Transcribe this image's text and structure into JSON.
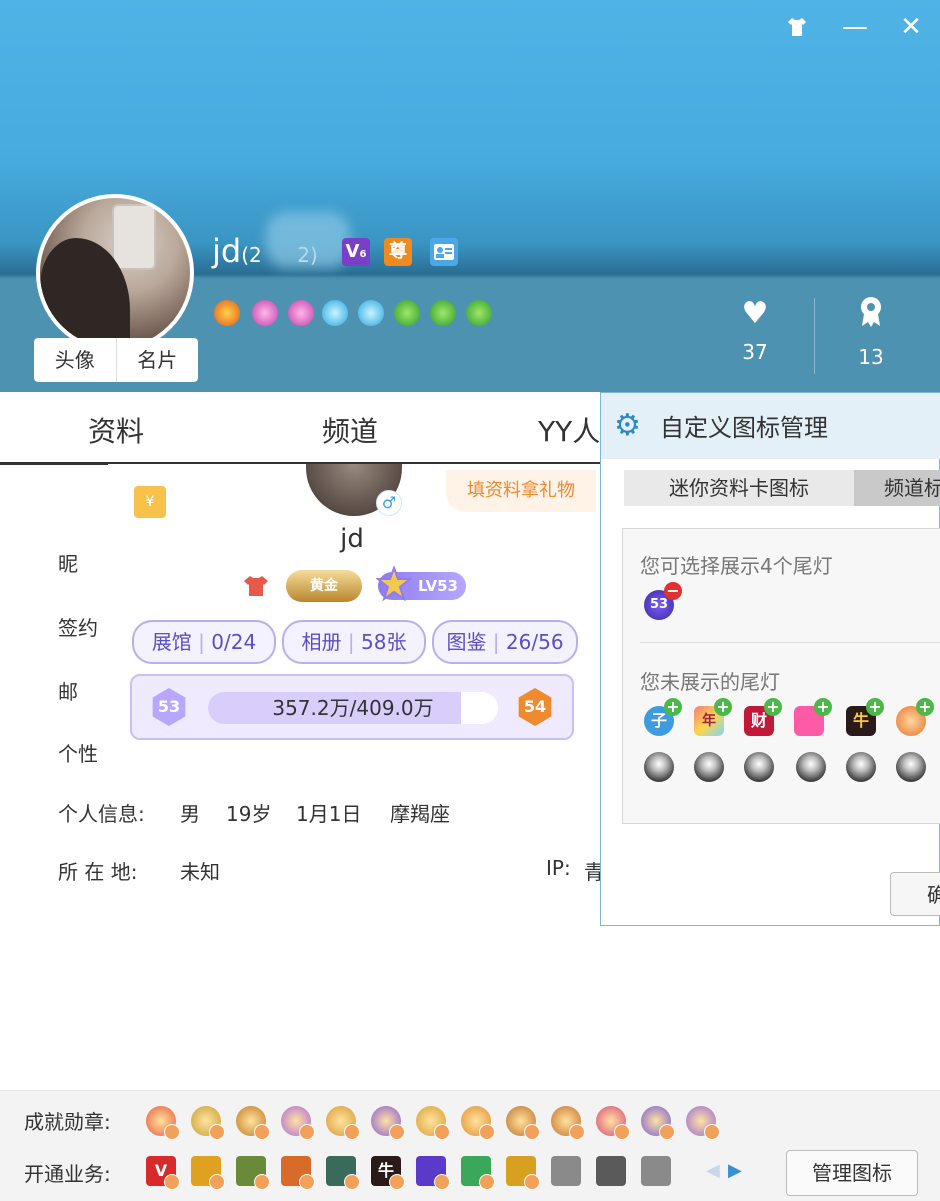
{
  "window": {
    "skin_icon": "shirt-icon",
    "minimize": "—",
    "close": "✕"
  },
  "profile": {
    "nickname": "jd",
    "uid_visible_start": "(2",
    "uid_visible_end": "2)",
    "badge_v": "V",
    "badge_v_sub": "6",
    "badge_zun": "尊",
    "avatar_tabs": [
      "头像",
      "名片"
    ],
    "likes": "37",
    "followers": "13"
  },
  "tabs": [
    "资料",
    "频道",
    "YY人"
  ],
  "info_rows": {
    "nickname_label": "昵",
    "sign_label": "签约",
    "email_label": "邮",
    "signature_label": "个性",
    "personal_label": "个人信息:",
    "gender": "男",
    "age": "19岁",
    "birthday": "1月1日",
    "zodiac": "摩羯座",
    "location_label": "所 在 地:",
    "location": "未知",
    "ip_label": "IP:",
    "ip_value": "青"
  },
  "card": {
    "name": "jd",
    "gender_icon": "♂",
    "fill_gift": "填资料拿礼物",
    "red_packet": "¥",
    "rank_badge": "黄金",
    "level": "LV53",
    "pills": [
      {
        "label": "展馆",
        "value": "0/24"
      },
      {
        "label": "相册",
        "value": "58张"
      },
      {
        "label": "图鉴",
        "value": "26/56"
      }
    ],
    "level_current": "53",
    "level_next": "54",
    "exp_text_a": "357.2万",
    "exp_text_b": "/409.0万",
    "exp_progress": 0.873
  },
  "panel": {
    "title": "自定义图标管理",
    "tab_mini": "迷你资料卡图标",
    "tab_channel": "频道标",
    "can_show": "您可选择展示4个尾灯",
    "not_shown": "您未展示的尾灯",
    "shown_icon_label": "53",
    "hidden_icon_labels": [
      "子",
      "年",
      "财",
      "",
      "牛",
      ""
    ],
    "confirm": "确"
  },
  "bottom": {
    "medals_label": "成就勋章:",
    "services_label": "开通业务:",
    "service_labels": [
      "V",
      "",
      "",
      "",
      "",
      "牛",
      "",
      "",
      "",
      "",
      "",
      ""
    ],
    "manage_button": "管理图标"
  },
  "colors": {
    "header_blue": "#4fb3e6",
    "accent_purple": "#5b4fc4",
    "orange": "#f08a2e"
  }
}
